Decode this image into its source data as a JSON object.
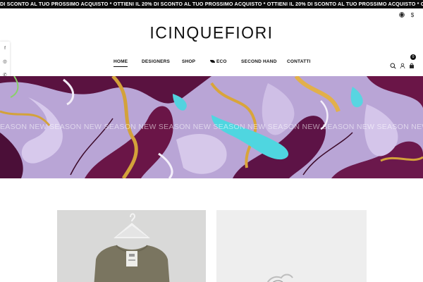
{
  "announcement": {
    "text": "DI SCONTO AL TUO PROSSIMO ACQUISTO * OTTIENI IL 20% DI SCONTO AL TUO PROSSIMO ACQUISTO * OTTIENI IL 20% DI SCONTO AL TUO PROSSIMO ACQUISTO * OTTIENI IL 20% DI SCONTO AL TUO PROSSIMO ACQUISTO"
  },
  "header": {
    "logo": "ICINQUEFIORI",
    "utility_icons": [
      "globe-icon",
      "currency-dollar-icon"
    ],
    "currency_symbol": "$",
    "cart_count": "0",
    "right_icons": [
      "search-icon",
      "user-icon",
      "bag-icon"
    ]
  },
  "nav": {
    "items": [
      {
        "label": "HOME",
        "active": true
      },
      {
        "label": "DESIGNERS",
        "active": false
      },
      {
        "label": "SHOP",
        "active": false
      },
      {
        "label": "ECO",
        "active": false,
        "icon": "leaf-icon"
      },
      {
        "label": "SECOND HAND",
        "active": false
      },
      {
        "label": "CONTATTI",
        "active": false
      }
    ]
  },
  "social": {
    "items": [
      {
        "icon": "facebook-icon",
        "glyph": "f"
      },
      {
        "icon": "instagram-icon",
        "glyph": "◎"
      },
      {
        "icon": "whatsapp-icon",
        "glyph": "✆"
      }
    ]
  },
  "banner": {
    "overlay_text": "EASON NEW SEASON NEW SEASON NEW SEASON NEW SEASON NEW SEASON NEW SEASON NEW SEASON NEW SEASON NEW SEASON NEW SEASON NEW SEASON NEW SEASON"
  },
  "products": [
    {
      "image": "olive-sleeveless-top-on-hanger"
    },
    {
      "image": "silver-item"
    }
  ],
  "colors": {
    "ticker_bg": "#0b0b0b",
    "banner_lilac": "#b9a5d6",
    "banner_purple": "#6a1547",
    "banner_gold": "#d3a23a",
    "banner_cyan": "#4fd6e0"
  }
}
